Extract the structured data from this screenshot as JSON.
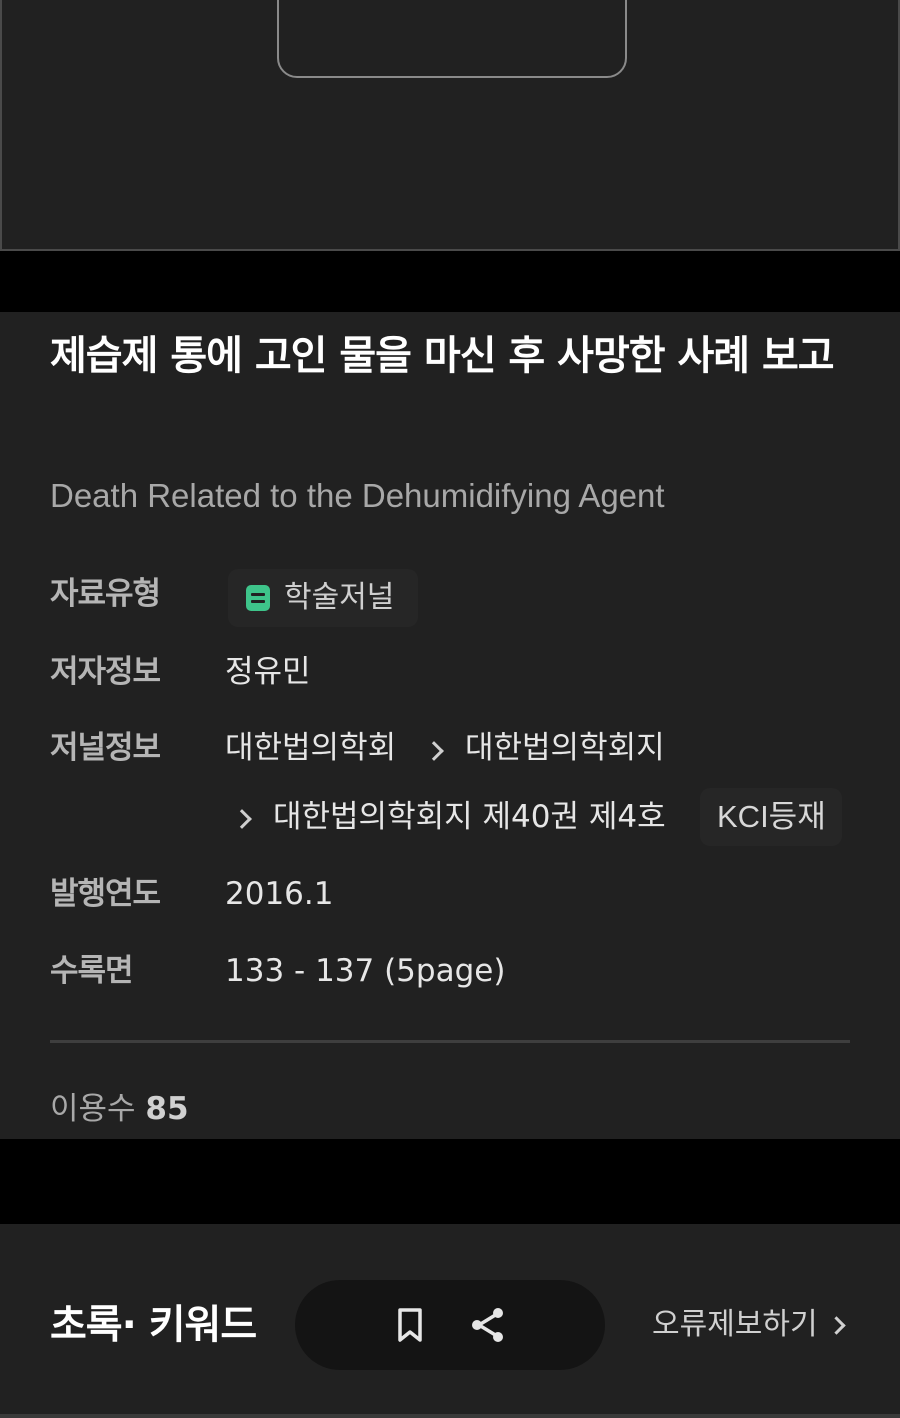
{
  "article": {
    "title_ko": "제습제 통에 고인 물을 마신 후 사망한 사례 보고",
    "title_en": "Death Related to the Dehumidifying Agent"
  },
  "meta": {
    "type_label": "자료유형",
    "type_value": "학술저널",
    "type_icon": "journal-icon",
    "author_label": "저자정보",
    "author_value": "정유민",
    "journal_label": "저널정보",
    "journal_breadcrumb": [
      "대한법의학회",
      "대한법의학회지",
      "대한법의학회지 제40권 제4호"
    ],
    "kci_badge": "KCI등재",
    "year_label": "발행연도",
    "year_value": "2016.1",
    "pages_label": "수록면",
    "pages_value": "133 - 137 (5page)"
  },
  "usage": {
    "label": "이용수",
    "count": "85"
  },
  "bottom_bar": {
    "section_title": "초록· 키워드",
    "bookmark_icon": "bookmark-icon",
    "share_icon": "share-icon",
    "report_label": "오류제보하기"
  },
  "colors": {
    "panel_bg": "#212121",
    "page_bg": "#000000",
    "badge_icon": "#3ec48a"
  }
}
